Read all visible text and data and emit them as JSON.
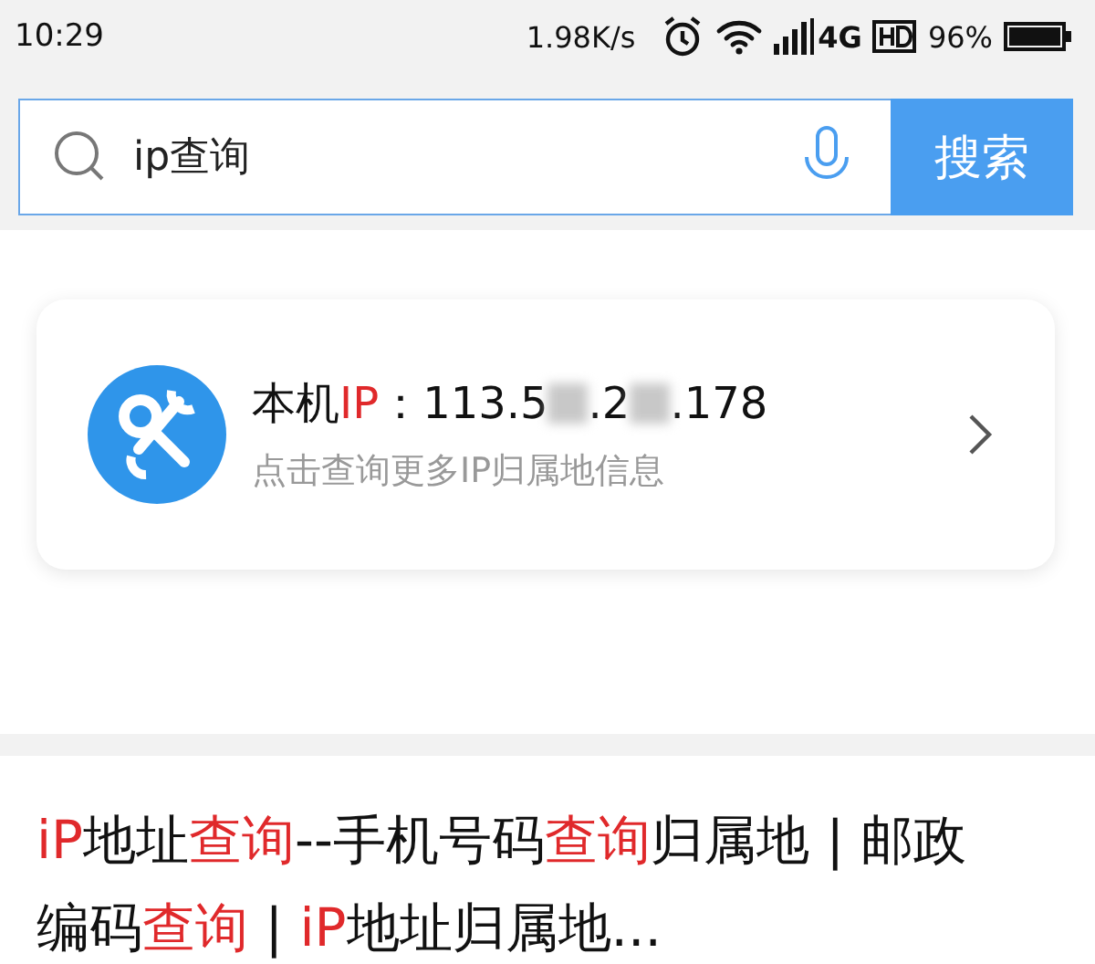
{
  "status_bar": {
    "time": "10:29",
    "speed": "1.98K/s",
    "network": "4G",
    "battery": "96%"
  },
  "search": {
    "value": "ip查询",
    "button": "搜索"
  },
  "ip_card": {
    "label": "本机",
    "label_highlight": "IP",
    "separator": "：",
    "ip_parts": [
      {
        "kind": "text",
        "text": "113.5"
      },
      {
        "kind": "redacted"
      },
      {
        "kind": "text",
        "text": ".2"
      },
      {
        "kind": "redacted"
      },
      {
        "kind": "text",
        "text": ".178"
      }
    ],
    "subtitle": "点击查询更多IP归属地信息"
  },
  "result": {
    "title": [
      {
        "text": "iP",
        "highlight": true
      },
      {
        "text": "地址",
        "highlight": false
      },
      {
        "text": "查询",
        "highlight": true
      },
      {
        "text": "--手机号码",
        "highlight": false
      },
      {
        "text": "查询",
        "highlight": true
      },
      {
        "text": "归属地 | 邮政编码",
        "highlight": false
      },
      {
        "text": "查询",
        "highlight": true
      },
      {
        "text": " | ",
        "highlight": false
      },
      {
        "text": "iP",
        "highlight": true
      },
      {
        "text": "地址归属地...",
        "highlight": false
      }
    ]
  }
}
